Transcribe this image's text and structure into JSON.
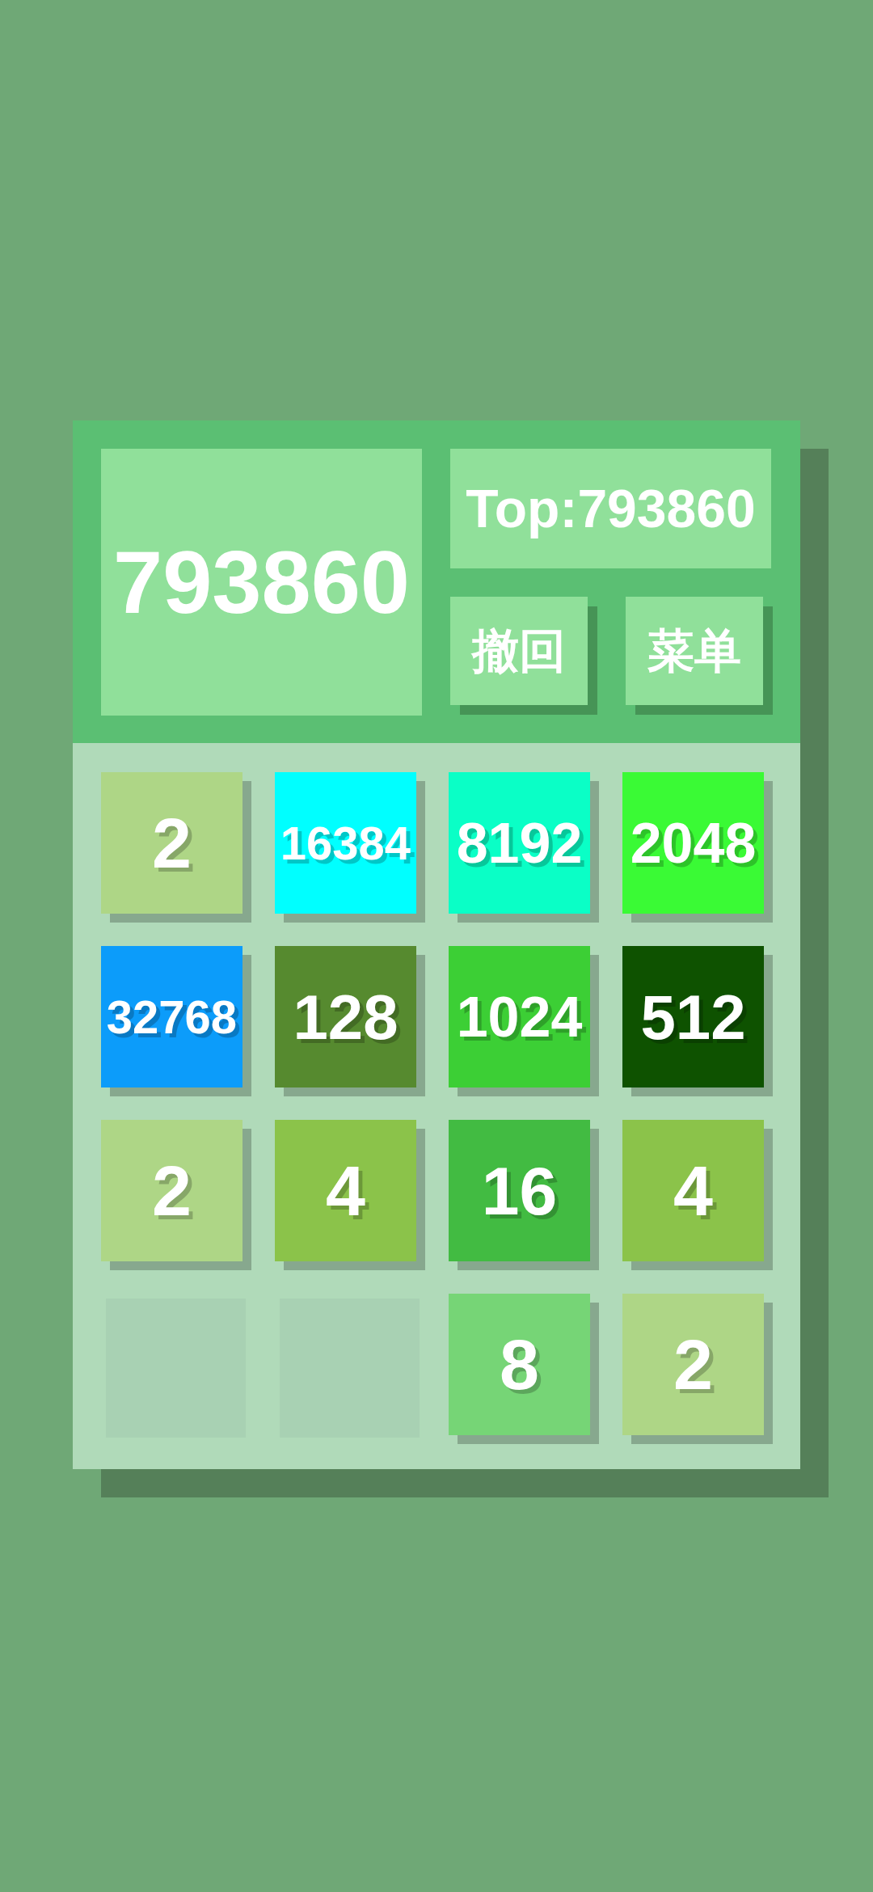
{
  "score": "793860",
  "top": "Top:793860",
  "buttons": [
    "撤回",
    "菜单"
  ],
  "board": {
    "rows": [
      [
        {
          "kind": "tile",
          "value": "2",
          "color": "#aed686"
        },
        {
          "kind": "tile",
          "value": "16384",
          "color": "#00ffff"
        },
        {
          "kind": "tile",
          "value": "8192",
          "color": "#0affc6"
        },
        {
          "kind": "tile",
          "value": "2048",
          "color": "#3afa35"
        }
      ],
      [
        {
          "kind": "tile",
          "value": "32768",
          "color": "#0c9cfa"
        },
        {
          "kind": "tile",
          "value": "128",
          "color": "#568a2f"
        },
        {
          "kind": "tile",
          "value": "1024",
          "color": "#3ccf35"
        },
        {
          "kind": "tile",
          "value": "512",
          "color": "#0e5200"
        }
      ],
      [
        {
          "kind": "tile",
          "value": "2",
          "color": "#aed686"
        },
        {
          "kind": "tile",
          "value": "4",
          "color": "#8bc34a"
        },
        {
          "kind": "tile",
          "value": "16",
          "color": "#42bb42"
        },
        {
          "kind": "tile",
          "value": "4",
          "color": "#8bc34a"
        }
      ],
      [
        {
          "kind": "empty"
        },
        {
          "kind": "empty"
        },
        {
          "kind": "tile",
          "value": "8",
          "color": "#76d576"
        },
        {
          "kind": "tile",
          "value": "2",
          "color": "#aed686"
        }
      ]
    ]
  }
}
